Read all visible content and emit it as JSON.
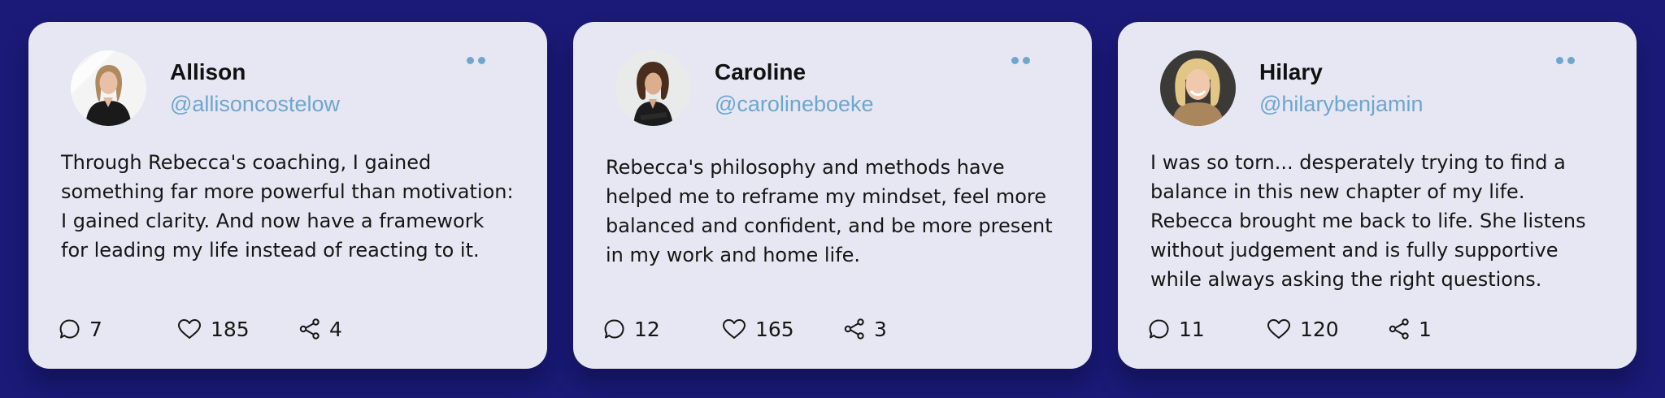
{
  "testimonials": [
    {
      "name": "Allison",
      "handle": "@allisoncostelow",
      "text": "Through Rebecca's coaching, I gained something far more powerful than motivation: I gained clarity. And now have a framework for leading my life instead of reacting to it.",
      "comments": "7",
      "likes": "185",
      "shares": "4"
    },
    {
      "name": "Caroline",
      "handle": "@carolineboeke",
      "text": "Rebecca's philosophy and methods have helped me to reframe my mindset, feel more balanced and confident, and be more present in my work and home life.",
      "comments": "12",
      "likes": "165",
      "shares": "3"
    },
    {
      "name": "Hilary",
      "handle": "@hilarybenjamin",
      "text": "I was so torn... desperately trying to find a balance in this new chapter of my life. Rebecca brought me back to life. She listens without judgement and is fully supportive while always asking the right questions.",
      "comments": "11",
      "likes": "120",
      "shares": "1"
    }
  ],
  "icons": {
    "comment": "comment-icon",
    "like": "heart-icon",
    "share": "share-icon",
    "menu": "more-dots-icon"
  },
  "colors": {
    "background": "#1b1a78",
    "card": "#e6e7f2",
    "handle": "#6fa6cd",
    "text": "#161616"
  }
}
